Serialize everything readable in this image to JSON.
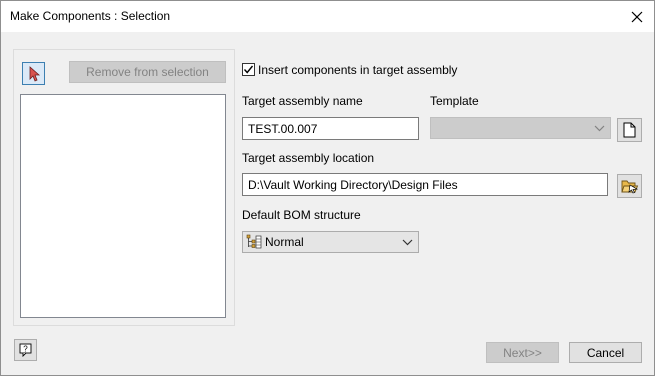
{
  "window": {
    "title": "Make Components : Selection",
    "close_icon": "close-icon"
  },
  "selection": {
    "select_tool_icon": "cursor-arrow-icon",
    "remove_label": "Remove from selection",
    "items": []
  },
  "options": {
    "insert_label": "Insert components in target assembly",
    "insert_checked": true,
    "assembly_name_label": "Target assembly name",
    "assembly_name_value": "TEST.00.007",
    "template_label": "Template",
    "template_value": "",
    "template_icon": "new-document-icon",
    "location_label": "Target assembly location",
    "location_value": "D:\\Vault Working Directory\\Design Files",
    "location_icon": "browse-folder-icon",
    "bom_label": "Default BOM structure",
    "bom_value": "Normal",
    "bom_icon": "bom-structure-icon"
  },
  "footer": {
    "help_icon": "help-icon",
    "next_label": "Next>>",
    "cancel_label": "Cancel"
  },
  "colors": {
    "accent": "#3c7fb1",
    "disabled_text": "#838383"
  }
}
